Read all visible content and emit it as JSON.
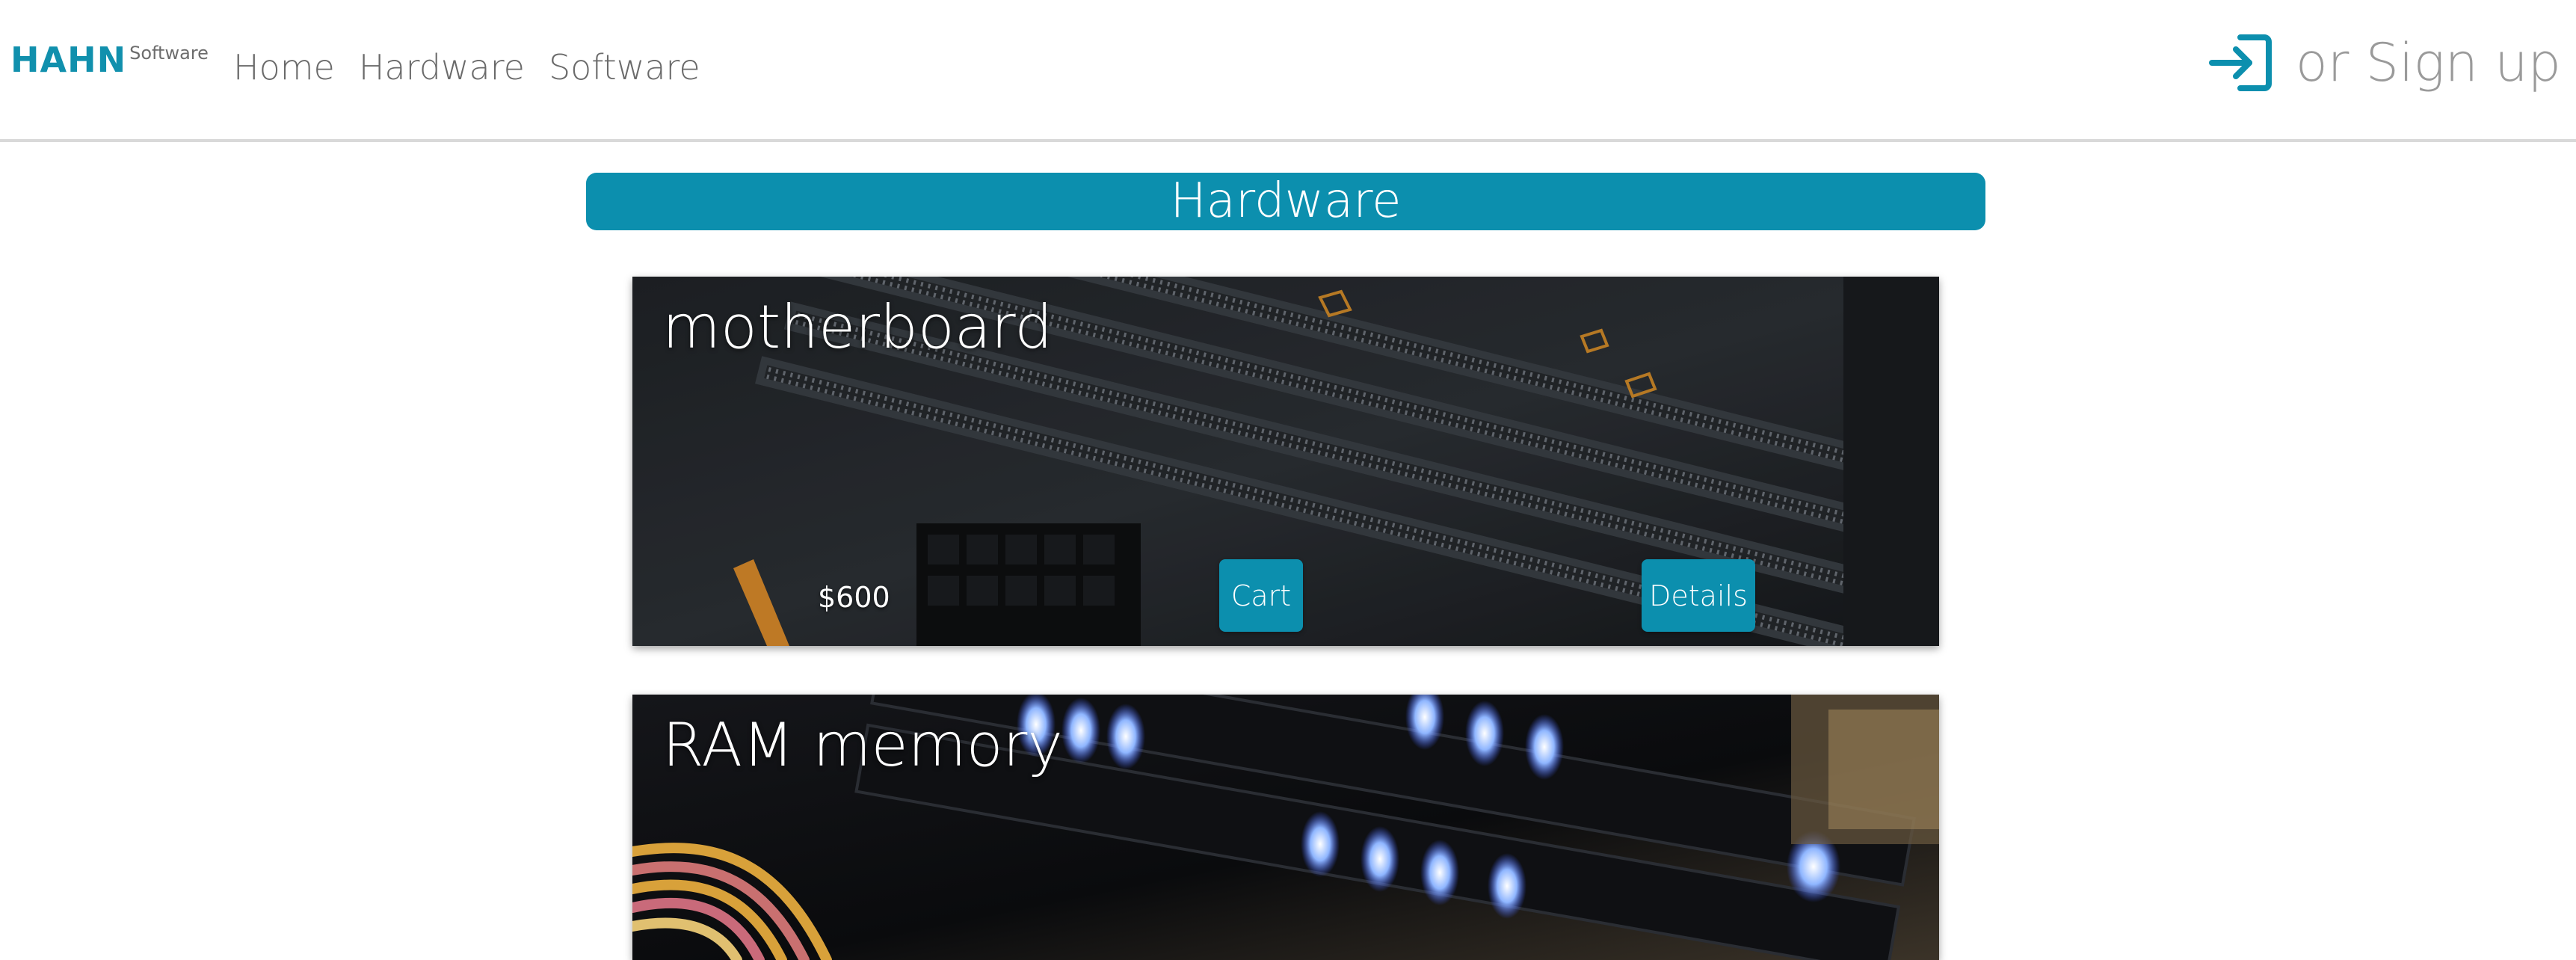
{
  "brand": {
    "name": "HAHN",
    "sub": "Software",
    "accent_color": "#0c8fae"
  },
  "nav": {
    "items": [
      {
        "label": "Home"
      },
      {
        "label": "Hardware"
      },
      {
        "label": "Software"
      }
    ]
  },
  "auth": {
    "login_icon": "login-arrow-icon",
    "signup_label": "or Sign up"
  },
  "section": {
    "title": "Hardware"
  },
  "products": [
    {
      "title": "motherboard",
      "price": "$600",
      "cart_label": "Cart",
      "details_label": "Details",
      "image_icon": "motherboard-photo"
    },
    {
      "title": "RAM memory",
      "image_icon": "ram-memory-photo"
    }
  ]
}
